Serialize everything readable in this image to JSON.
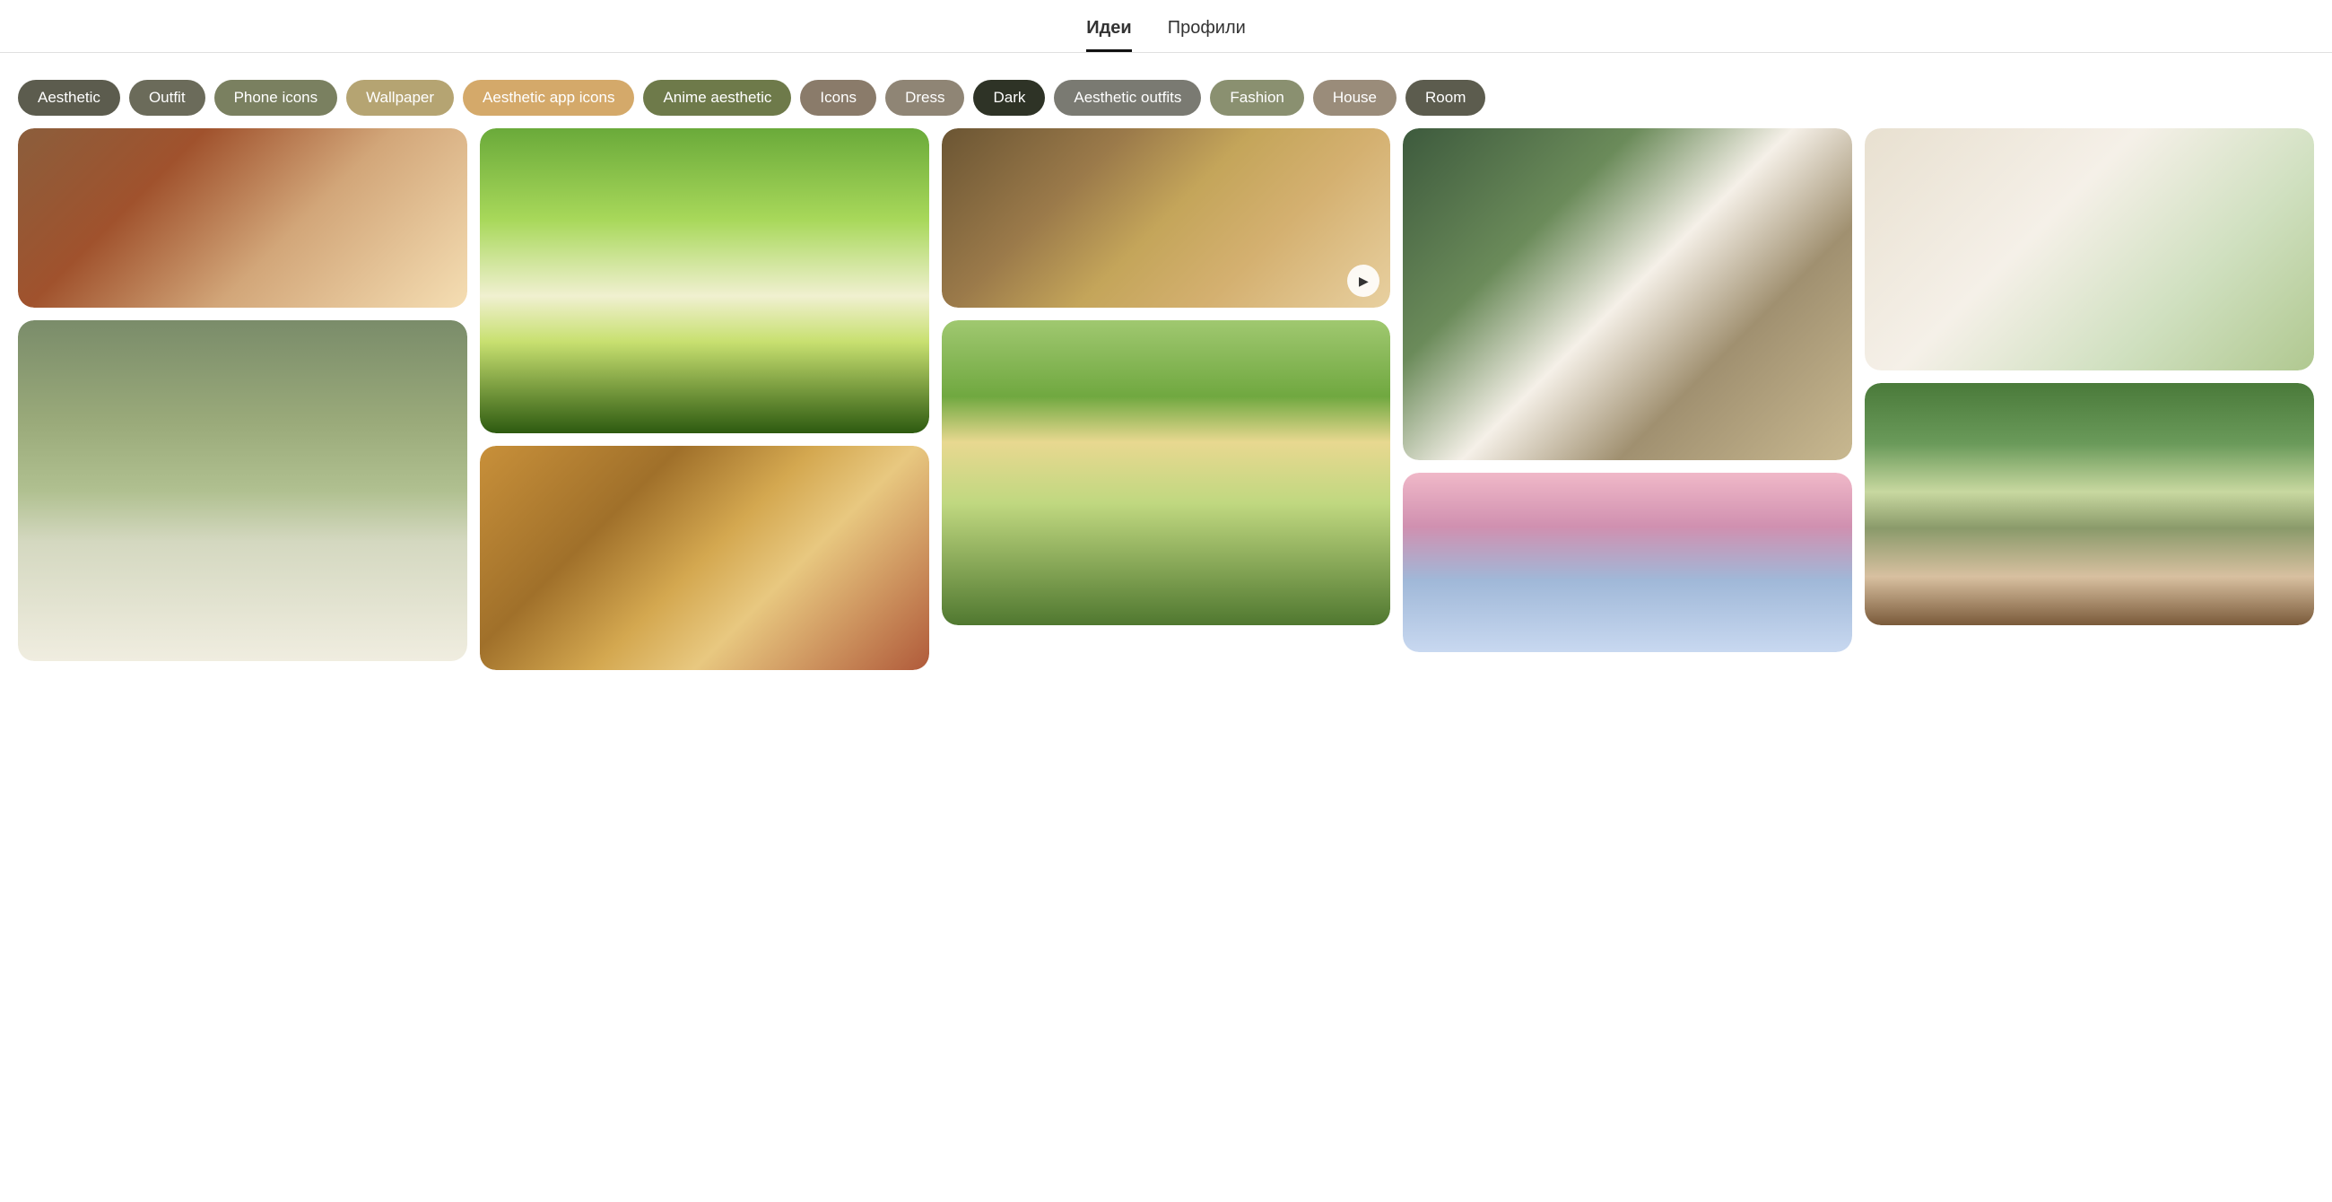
{
  "header": {
    "tab_ideas": "Идеи",
    "tab_profiles": "Профили"
  },
  "chips": [
    {
      "id": "aesthetic",
      "label": "Aesthetic",
      "style": "chip-gray-dark"
    },
    {
      "id": "outfit",
      "label": "Outfit",
      "style": "chip-gray-mid"
    },
    {
      "id": "phone-icons",
      "label": "Phone icons",
      "style": "chip-green-gray"
    },
    {
      "id": "wallpaper",
      "label": "Wallpaper",
      "style": "chip-tan"
    },
    {
      "id": "aesthetic-app-icons",
      "label": "Aesthetic app icons",
      "style": "chip-peach"
    },
    {
      "id": "anime-aesthetic",
      "label": "Anime aesthetic",
      "style": "chip-olive"
    },
    {
      "id": "icons",
      "label": "Icons",
      "style": "chip-taupe"
    },
    {
      "id": "dress",
      "label": "Dress",
      "style": "chip-warm-gray"
    },
    {
      "id": "dark",
      "label": "Dark",
      "style": "chip-dark-forest"
    },
    {
      "id": "aesthetic-outfits",
      "label": "Aesthetic outfits",
      "style": "chip-gray-light"
    },
    {
      "id": "fashion",
      "label": "Fashion",
      "style": "chip-sage-light"
    },
    {
      "id": "house",
      "label": "House",
      "style": "chip-dusty"
    },
    {
      "id": "room",
      "label": "Room",
      "style": "chip-gray-dark"
    }
  ],
  "grid_columns": [
    {
      "items": [
        {
          "id": "kitchen-table",
          "class": "img-kitchen-table",
          "has_video": false
        },
        {
          "id": "white-cat",
          "class": "img-white-cat",
          "has_video": false
        }
      ]
    },
    {
      "items": [
        {
          "id": "forest-meadow",
          "class": "img-forest-meadow",
          "has_video": false
        },
        {
          "id": "picnic-basket",
          "class": "img-picnic-basket",
          "has_video": false
        }
      ]
    },
    {
      "items": [
        {
          "id": "candles-books",
          "class": "img-candles-books",
          "has_video": true
        },
        {
          "id": "window-garden",
          "class": "img-window-garden",
          "has_video": false
        }
      ]
    },
    {
      "items": [
        {
          "id": "cozy-room",
          "class": "img-cozy-room",
          "has_video": false
        },
        {
          "id": "pink-sky",
          "class": "img-pink-sky",
          "has_video": false
        }
      ]
    },
    {
      "items": [
        {
          "id": "bright-kitchen",
          "class": "img-bright-kitchen",
          "has_video": false
        },
        {
          "id": "fairy-cottage",
          "class": "img-fairy-cottage",
          "has_video": false
        }
      ]
    }
  ],
  "icons": {
    "play": "▶"
  }
}
